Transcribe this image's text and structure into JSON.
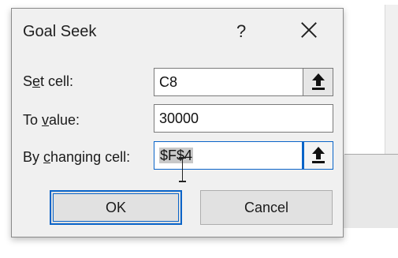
{
  "dialog": {
    "title": "Goal Seek",
    "help_label": "?",
    "close_icon": "close-icon"
  },
  "fields": {
    "set_cell": {
      "label_pre": "S",
      "label_u": "e",
      "label_post": "t cell:",
      "value": "C8"
    },
    "to_value": {
      "label_pre": "To ",
      "label_u": "v",
      "label_post": "alue:",
      "value": "30000"
    },
    "by_changing": {
      "label_pre": "By ",
      "label_u": "c",
      "label_post": "hanging cell:",
      "value": "$F$4"
    }
  },
  "buttons": {
    "ok": "OK",
    "cancel": "Cancel"
  },
  "icons": {
    "collapse": "collapse-dialog-icon",
    "cursor": "text-cursor-icon"
  },
  "colors": {
    "accent": "#0a64c8",
    "dialog_bg": "#f0f0f0"
  }
}
